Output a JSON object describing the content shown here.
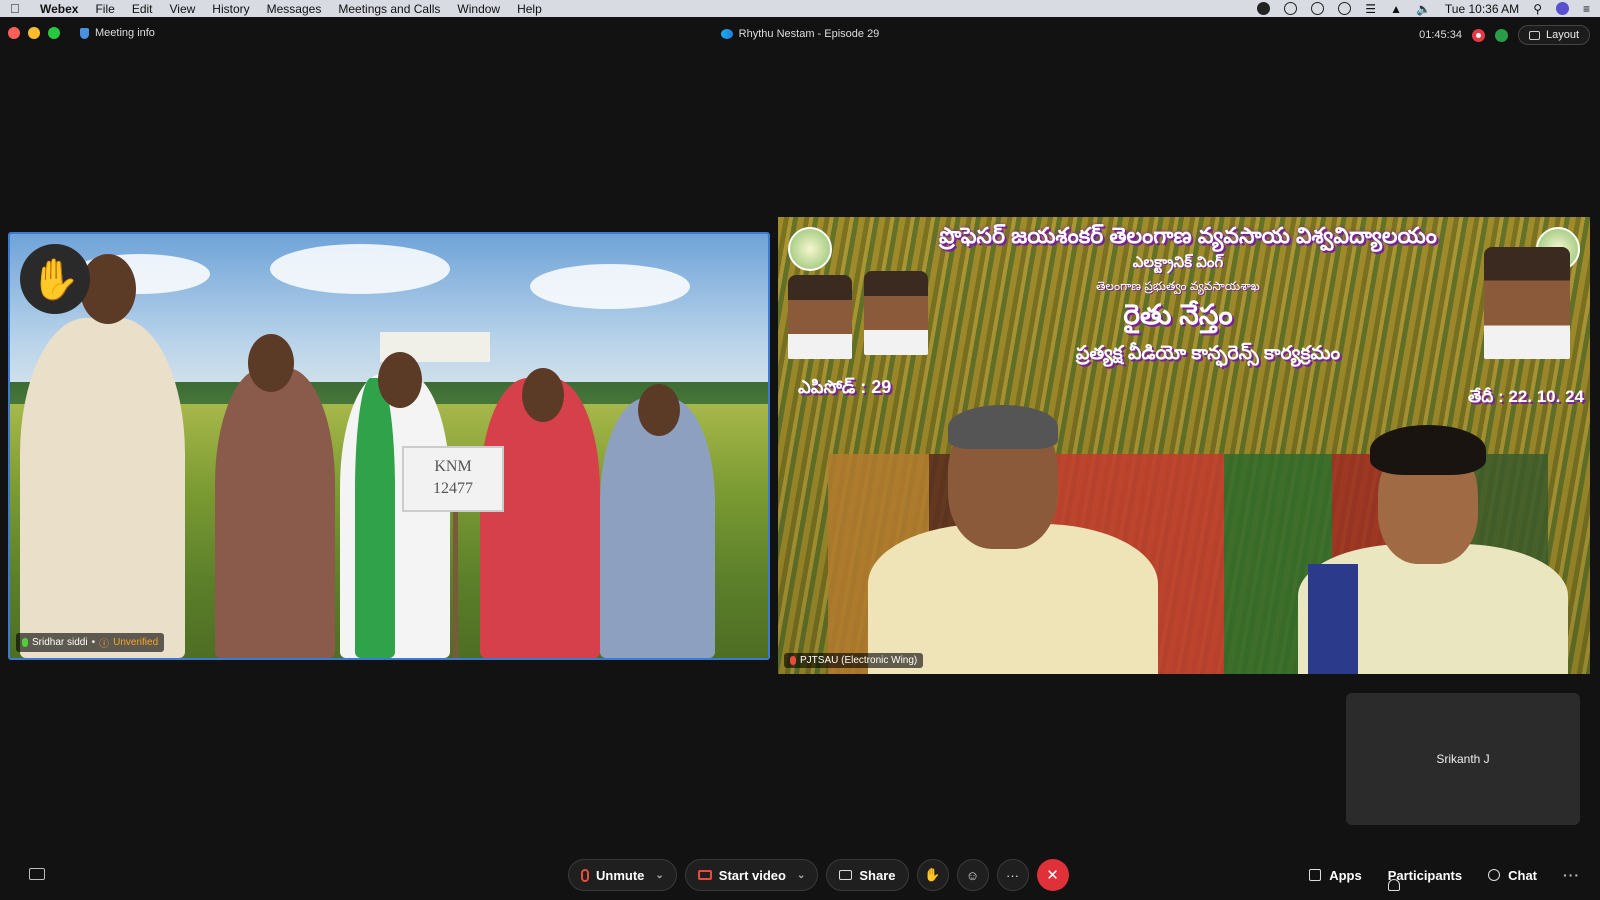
{
  "menubar": {
    "apple_icon": "apple-logo",
    "items": [
      "Webex",
      "File",
      "Edit",
      "View",
      "History",
      "Messages",
      "Meetings and Calls",
      "Window",
      "Help"
    ],
    "clock": "Tue 10:36 AM"
  },
  "window": {
    "meeting_info": "Meeting info",
    "title": "Rhythu Nestam - Episode 29",
    "elapsed": "01:45:34",
    "layout_label": "Layout"
  },
  "tiles": {
    "left": {
      "name": "Sridhar siddi",
      "separator": "•",
      "status": "Unverified",
      "sign_text": [
        "KNM",
        "12477"
      ]
    },
    "right": {
      "name": "PJTSAU (Electronic Wing)",
      "banner_title": "ప్రొఫెసర్ జయశంకర్ తెలంగాణ వ్యవసాయ విశ్వవిద్యాలయం",
      "banner_sub": "ఎలక్ట్రానిక్ వింగ్",
      "banner_sub2": "తెలంగాణ ప్రభుత్వం  వ్యవసాయశాఖ",
      "banner_main": "రైతు నేస్తం",
      "banner_sub3": "ప్రత్యక్ష వీడియో కాన్ఫరెన్స్ కార్యక్రమం",
      "banner_episode": "ఎపిసోడ్ : 29",
      "banner_date": "తేదీ : 22. 10. 24"
    },
    "self": {
      "name": "Srikanth J"
    }
  },
  "controls": {
    "unmute": "Unmute",
    "start_video": "Start video",
    "share": "Share",
    "more": "···"
  },
  "right_controls": {
    "apps": "Apps",
    "participants": "Participants",
    "chat": "Chat",
    "more": "···"
  },
  "colors": {
    "accent": "#3a7bd5",
    "end_call": "#e0303a",
    "muted": "#e74c3c",
    "raise_hand": "#f4b400",
    "unverified": "#f6a623"
  }
}
